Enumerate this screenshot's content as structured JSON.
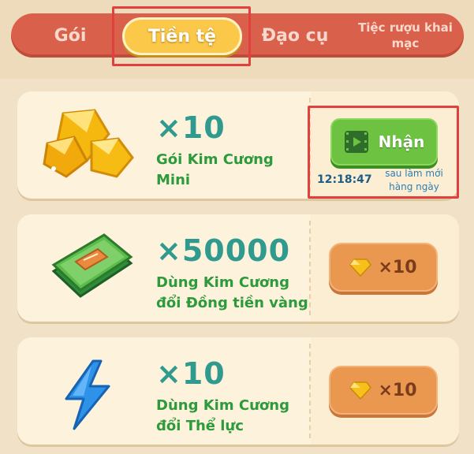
{
  "tabs": {
    "pack": "Gói",
    "currency": "Tiền tệ",
    "items": "Đạo cụ",
    "party_line1": "Tiệc rượu khai",
    "party_line2": "mạc"
  },
  "offers": [
    {
      "amount": "×10",
      "desc_line1": "Gói Kim Cương",
      "desc_line2": "Mini",
      "button_label": "Nhận",
      "timer": "12:18:47",
      "refresh_line1": "sau làm mới",
      "refresh_line2": "hàng ngày",
      "icon": "gold-diamonds-icon"
    },
    {
      "amount": "×50000",
      "desc_line1": "Dùng Kim Cương",
      "desc_line2": "đổi Đồng tiền vàng",
      "price": "×10",
      "icon": "cash-stack-icon"
    },
    {
      "amount": "×10",
      "desc_line1": "Dùng Kim Cương",
      "desc_line2": "đổi Thể lực",
      "price": "×10",
      "icon": "lightning-icon"
    }
  ],
  "colors": {
    "tab_bar": "#d9614c",
    "active_tab": "#fbc84a",
    "amount": "#2f9a8d",
    "desc": "#2d9a3c",
    "claim_button": "#6dc241",
    "price_button": "#ea9850"
  }
}
